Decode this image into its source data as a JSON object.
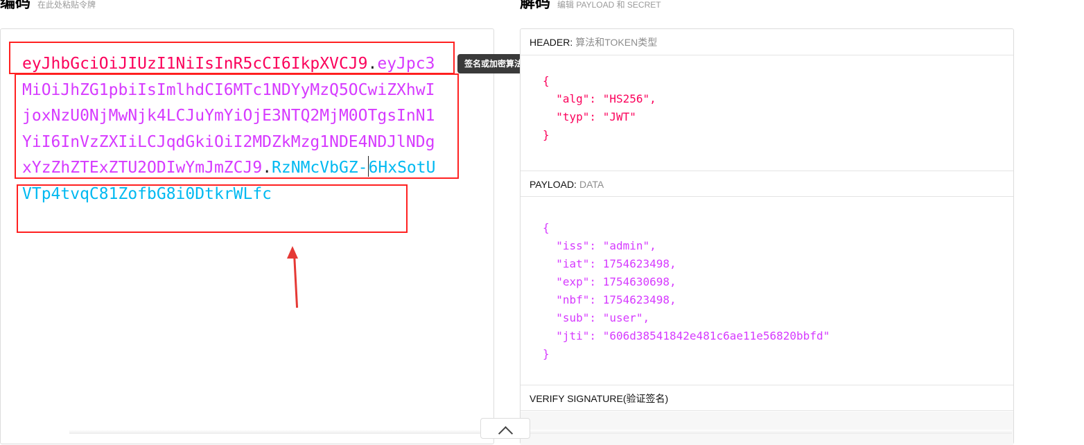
{
  "headings": {
    "encoded_title": "编码",
    "encoded_subtitle": "在此处粘贴令牌",
    "decoded_title": "解码",
    "decoded_subtitle": "编辑 PAYLOAD 和 SECRET"
  },
  "token": {
    "header_part": "eyJhbGciOiJIUzI1NiIsInR5cCI6IkpXVCJ9",
    "payload_part": "eyJpc3MiOiJhZG1pbiIsImlhdCI6MTc1NDYyMzQ5OCwiZXhwIjoxNzU0NjMwNjk4LCJuYmYiOjE3NTQ2MjM0OTgsInN1YiI6InVzZXIiLCJqdGkiOiI2MDZkMzg1NDE4NDJlNDgxYzZhZTExZTU2ODIwYmJmZCJ9",
    "sig_part_a": "RzNMcVbGZ-",
    "sig_part_b": "6HxSotUVTp4tvqC81ZofbG8i0DtkrWLfc",
    "dot": "."
  },
  "tooltip": "签名或加密算法",
  "sections": {
    "header_label": "HEADER:",
    "header_sub": "算法和TOKEN类型",
    "payload_label": "PAYLOAD:",
    "payload_sub": "DATA",
    "verify_label": "VERIFY SIGNATURE(验证签名)"
  },
  "header_json": "{\n  \"alg\": \"HS256\",\n  \"typ\": \"JWT\"\n}",
  "payload_json": "{\n  \"iss\": \"admin\",\n  \"iat\": 1754623498,\n  \"exp\": 1754630698,\n  \"nbf\": 1754623498,\n  \"sub\": \"user\",\n  \"jti\": \"606d38541842e481c6ae11e56820bbfd\"\n}",
  "colors": {
    "header": "#fb015b",
    "payload": "#d63aff",
    "signature": "#00b9f1",
    "annotation": "#ff2020"
  },
  "icons": {
    "scroll": "chevron-up-icon",
    "annotation_arrow": "arrow-up-icon"
  }
}
